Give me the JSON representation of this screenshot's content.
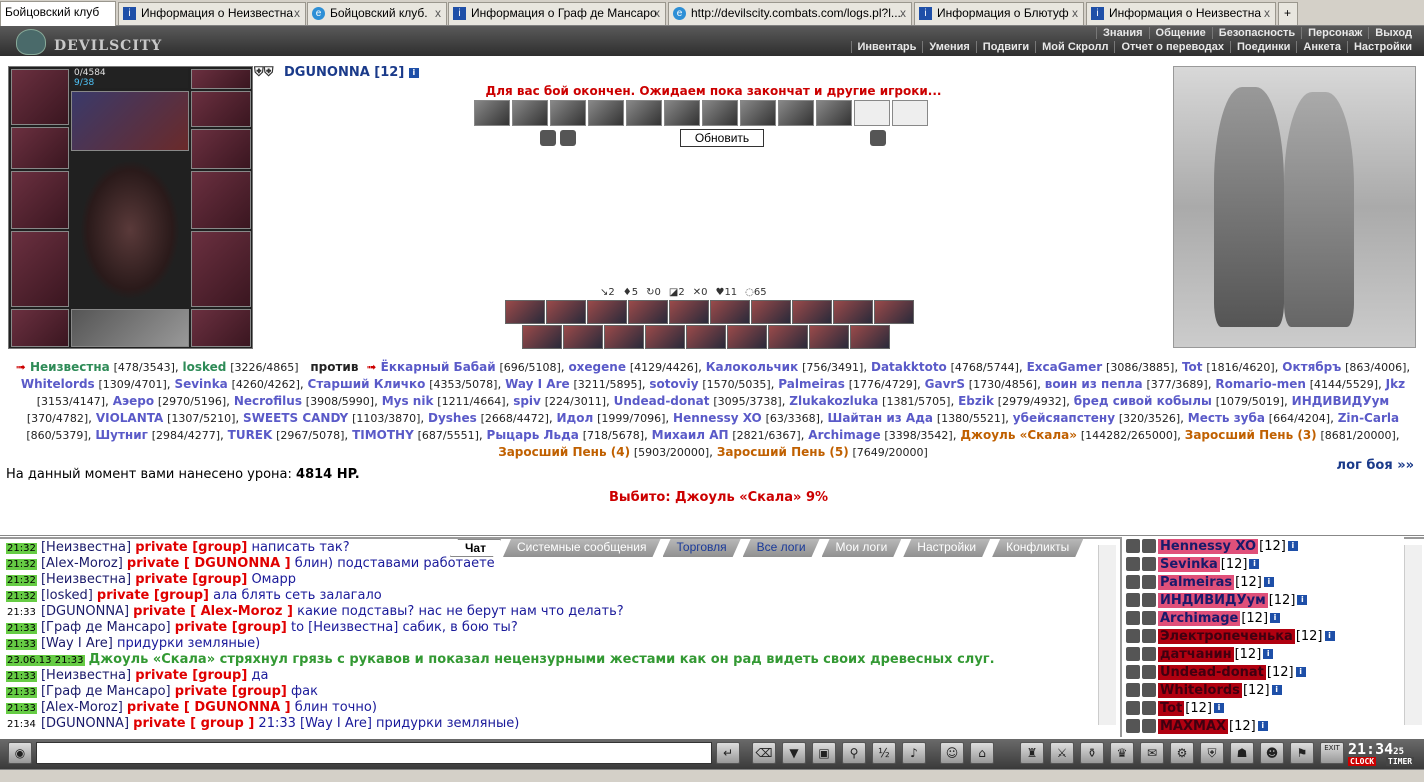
{
  "browser": {
    "tabs": [
      {
        "label": "Бойцовский клуб",
        "active": true,
        "icon": "none"
      },
      {
        "label": "Информация о Неизвестна",
        "icon": "info-icon"
      },
      {
        "label": "Бойцовский клуб.",
        "icon": "ie-icon"
      },
      {
        "label": "Информация о Граф де Мансаро",
        "icon": "info-icon"
      },
      {
        "label": "http://devilscity.combats.com/logs.pl?l...",
        "icon": "ie-icon"
      },
      {
        "label": "Информация о Блютуф",
        "icon": "info-icon"
      },
      {
        "label": "Информация о Неизвестна",
        "icon": "info-icon"
      }
    ],
    "close_glyph": "x",
    "new_tab_glyph": "+"
  },
  "header": {
    "logo": "DEVILSCITY",
    "nav_top": [
      "Знания",
      "Общение",
      "Безопасность",
      "Персонаж",
      "Выход"
    ],
    "nav_bottom": [
      "Инвентарь",
      "Умения",
      "Подвиги",
      "Мой Скролл",
      "Отчет о переводах",
      "Поединки",
      "Анкета",
      "Настройки"
    ]
  },
  "character": {
    "name": "DGUNONNA [12]",
    "hp": "0/4584",
    "mana": "9/38"
  },
  "battle": {
    "status_message": "Для вас бой окончен. Ожидаем пока закончат и другие игроки...",
    "refresh_button": "Обновить",
    "stats": [
      {
        "icon": "sword-icon",
        "value": "2"
      },
      {
        "icon": "blood-icon",
        "value": "5"
      },
      {
        "icon": "counter-icon",
        "value": "0"
      },
      {
        "icon": "block-icon",
        "value": "2"
      },
      {
        "icon": "cross-icon",
        "value": "0"
      },
      {
        "icon": "heart-icon",
        "value": "11"
      },
      {
        "icon": "shield-icon",
        "value": "65"
      }
    ],
    "team1": [
      {
        "name": "Неизвестна",
        "hp": "[478/3543]",
        "style": "g"
      },
      {
        "name": "losked",
        "hp": "[3226/4865]",
        "style": "g"
      }
    ],
    "versus": "против",
    "team2": [
      {
        "name": "Ёккарный Бабай",
        "hp": "[696/5108]",
        "style": "a"
      },
      {
        "name": "oxegene",
        "hp": "[4129/4426]",
        "style": "a"
      },
      {
        "name": "Калокольчик",
        "hp": "[756/3491]",
        "style": "a"
      },
      {
        "name": "Datakktoto",
        "hp": "[4768/5744]",
        "style": "a"
      },
      {
        "name": "ExcaGamer",
        "hp": "[3086/3885]",
        "style": "a"
      },
      {
        "name": "Tot",
        "hp": "[1816/4620]",
        "style": "a"
      },
      {
        "name": "Октябръ",
        "hp": "[863/4006]",
        "style": "a"
      },
      {
        "name": "Whitelords",
        "hp": "[1309/4701]",
        "style": "a"
      },
      {
        "name": "Sevinka",
        "hp": "[4260/4262]",
        "style": "a"
      },
      {
        "name": "Старший Кличко",
        "hp": "[4353/5078]",
        "style": "a"
      },
      {
        "name": "Way I Are",
        "hp": "[3211/5895]",
        "style": "a"
      },
      {
        "name": "sotoviy",
        "hp": "[1570/5035]",
        "style": "a"
      },
      {
        "name": "Palmeiras",
        "hp": "[1776/4729]",
        "style": "a"
      },
      {
        "name": "GavrS",
        "hp": "[1730/4856]",
        "style": "a"
      },
      {
        "name": "воин из пепла",
        "hp": "[377/3689]",
        "style": "a"
      },
      {
        "name": "Romario-men",
        "hp": "[4144/5529]",
        "style": "a"
      },
      {
        "name": "Jkz",
        "hp": "[3153/4147]",
        "style": "a"
      },
      {
        "name": "Аэеро",
        "hp": "[2970/5196]",
        "style": "a"
      },
      {
        "name": "Necrofilus",
        "hp": "[3908/5990]",
        "style": "a"
      },
      {
        "name": "Mys nik",
        "hp": "[1211/4664]",
        "style": "a"
      },
      {
        "name": "spiv",
        "hp": "[224/3011]",
        "style": "a"
      },
      {
        "name": "Undead-donat",
        "hp": "[3095/3738]",
        "style": "a"
      },
      {
        "name": "Zlukakozluka",
        "hp": "[1381/5705]",
        "style": "a"
      },
      {
        "name": "Ebzik",
        "hp": "[2979/4932]",
        "style": "a"
      },
      {
        "name": "бред сивой кобылы",
        "hp": "[1079/5019]",
        "style": "a"
      },
      {
        "name": "ИНДИВИДУум",
        "hp": "[370/4782]",
        "style": "a"
      },
      {
        "name": "VIOLANTA",
        "hp": "[1307/5210]",
        "style": "a"
      },
      {
        "name": "SWEETS CANDY",
        "hp": "[1103/3870]",
        "style": "a"
      },
      {
        "name": "Dyshes",
        "hp": "[2668/4472]",
        "style": "a"
      },
      {
        "name": "Идол",
        "hp": "[1999/7096]",
        "style": "a"
      },
      {
        "name": "Hennessy XO",
        "hp": "[63/3368]",
        "style": "a"
      },
      {
        "name": "Шайтан из Ада",
        "hp": "[1380/5521]",
        "style": "a"
      },
      {
        "name": "убейсяапстену",
        "hp": "[320/3526]",
        "style": "a"
      },
      {
        "name": "Месть зуба",
        "hp": "[664/4204]",
        "style": "a"
      },
      {
        "name": "Zin-Carla",
        "hp": "[860/5379]",
        "style": "a"
      },
      {
        "name": "Шутниг",
        "hp": "[2984/4277]",
        "style": "a"
      },
      {
        "name": "TUREK",
        "hp": "[2967/5078]",
        "style": "a"
      },
      {
        "name": "TIMOTHY",
        "hp": "[687/5551]",
        "style": "a"
      },
      {
        "name": "Рыцарь Льда",
        "hp": "[718/5678]",
        "style": "a"
      },
      {
        "name": "Михаил АП",
        "hp": "[2821/6367]",
        "style": "a"
      },
      {
        "name": "Archimage",
        "hp": "[3398/3542]",
        "style": "a"
      },
      {
        "name": "Джоуль «Скала»",
        "hp": "[144282/265000]",
        "style": "o"
      },
      {
        "name": "Заросший Пень (3)",
        "hp": "[8681/20000]",
        "style": "o"
      },
      {
        "name": "Заросший Пень (4)",
        "hp": "[5903/20000]",
        "style": "o"
      },
      {
        "name": "Заросший Пень (5)",
        "hp": "[7649/20000]",
        "style": "o"
      }
    ],
    "damage_label": "На данный момент вами нанесено урона:",
    "damage_value": "4814 HP.",
    "log_link": "лог боя »»",
    "knockout": "Выбито: Джоуль «Скала» 9%"
  },
  "chat": {
    "tabs": [
      {
        "label": "Чат",
        "active": true
      },
      {
        "label": "Системные сообщения"
      },
      {
        "label": "Торговля",
        "blue": true
      },
      {
        "label": "Все логи",
        "blue": true
      },
      {
        "label": "Мои логи"
      },
      {
        "label": "Настройки"
      },
      {
        "label": "Конфликты"
      }
    ],
    "lines": [
      {
        "time": "21:32",
        "hl": true,
        "nick": "[Неизвестна]",
        "priv": "private [group]",
        "msg": "написать так?"
      },
      {
        "time": "21:32",
        "hl": true,
        "nick": "[Alex-Moroz]",
        "priv": "private [ DGUNONNA ]",
        "msg": "блин) подставами работаете"
      },
      {
        "time": "21:32",
        "hl": true,
        "nick": "[Неизвестна]",
        "priv": "private [group]",
        "msg": "Омарр"
      },
      {
        "time": "21:32",
        "hl": true,
        "nick": "[losked]",
        "priv": "private [group]",
        "msg": "ала блять сеть залагало"
      },
      {
        "time": "21:33",
        "hl": false,
        "nick": "[DGUNONNA]",
        "priv": "private [ Alex-Moroz ]",
        "msg": "какие подставы? нас не берут нам что делать?"
      },
      {
        "time": "21:33",
        "hl": true,
        "nick": "[Граф де Мансаро]",
        "priv": "private [group]",
        "msg": "to [Неизвестна] сабик, в бою ты?"
      },
      {
        "time": "21:33",
        "hl": true,
        "nick": "[Way I Are]",
        "priv": "",
        "msg": "придурки земляные)"
      },
      {
        "time": "23.06.13 21:33",
        "hl": true,
        "sys": "Джоуль «Скала» стряхнул грязь с рукавов и показал нецензурными жестами как он рад видеть своих древесных слуг."
      },
      {
        "time": "21:33",
        "hl": true,
        "nick": "[Неизвестна]",
        "priv": "private [group]",
        "msg": "да"
      },
      {
        "time": "21:33",
        "hl": true,
        "nick": "[Граф де Мансаро]",
        "priv": "private [group]",
        "msg": "фак"
      },
      {
        "time": "21:33",
        "hl": true,
        "nick": "[Alex-Moroz]",
        "priv": "private [ DGUNONNA ]",
        "msg": "блин точно)"
      },
      {
        "time": "21:34",
        "hl": false,
        "nick": "[DGUNONNA]",
        "priv": "private [ group ]",
        "msg": "21:33 [Way I Are] придурки земляные)"
      }
    ],
    "input_value": ""
  },
  "userlist": [
    {
      "name": "Hennessy XO",
      "level": "[12]",
      "dark": false
    },
    {
      "name": "Sevinka",
      "level": "[12]",
      "dark": false
    },
    {
      "name": "Palmeiras",
      "level": "[12]",
      "dark": false
    },
    {
      "name": "ИНДИВИДУум",
      "level": "[12]",
      "dark": false
    },
    {
      "name": "Archimage",
      "level": "[12]",
      "dark": false
    },
    {
      "name": "Электропеченька",
      "level": "[12]",
      "dark": true
    },
    {
      "name": "датчанин",
      "level": "[12]",
      "dark": true
    },
    {
      "name": "Undead-donat",
      "level": "[12]",
      "dark": true
    },
    {
      "name": "Whitelords",
      "level": "[12]",
      "dark": true
    },
    {
      "name": "Tot",
      "level": "[12]",
      "dark": true
    },
    {
      "name": "MAXMAX",
      "level": "[12]",
      "dark": true
    }
  ],
  "clock": {
    "time": "21:34",
    "seconds": "25",
    "label_clock": "CLOCK",
    "label_timer": "TIMER",
    "exit": "EXIT"
  },
  "colors": {
    "accent_red": "#cc0000",
    "name_blue": "#5a5ac8",
    "team_green": "#2e8b57",
    "boss_orange": "#c06000",
    "time_highlight": "#66cc44"
  }
}
